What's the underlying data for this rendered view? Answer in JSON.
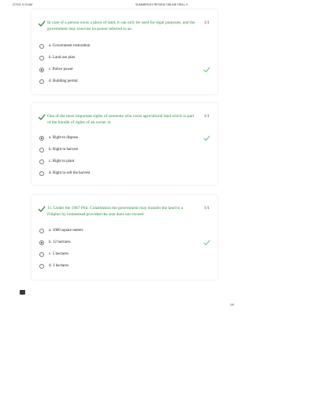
{
  "header": {
    "date": "2/7/23, 9:19 AM",
    "title": "SUMMERLEX REVIEW ONLINE DRILL 9"
  },
  "colors": {
    "correct_green": "#2e8b3c",
    "check_green": "#5cbf6a"
  },
  "questions": [
    {
      "text": "In case of a person owns a piece of land, it can only be used for legal purposes, and the government may exercise its power referred to as:",
      "points": "1/1",
      "status_icon": "check-icon",
      "options": [
        {
          "label": "a. Government restoration",
          "selected": false,
          "correct": false
        },
        {
          "label": "b. Land use plan",
          "selected": false,
          "correct": false
        },
        {
          "label": "c. Police power",
          "selected": true,
          "correct": true
        },
        {
          "label": "d. Building permit",
          "selected": false,
          "correct": false
        }
      ]
    },
    {
      "text": "One of the most important rights of someone who owns agricultural land which is part of the bundle of rights of an owner is:",
      "points": "1/1",
      "status_icon": "check-icon",
      "options": [
        {
          "label": "a. Right to dispose",
          "selected": true,
          "correct": true
        },
        {
          "label": "b. Right to harvest",
          "selected": false,
          "correct": false
        },
        {
          "label": "c. Right to plant",
          "selected": false,
          "correct": false
        },
        {
          "label": "d. Right to sell the harvest",
          "selected": false,
          "correct": false
        }
      ]
    },
    {
      "text": "11.     Under the 1987 Phil. Constitution the government may transfer the land to a Filipino by homestead provided the size does not exceed",
      "points": "1/1",
      "status_icon": "check-icon",
      "options": [
        {
          "label": "a. 1000 square meters",
          "selected": false,
          "correct": false
        },
        {
          "label": "b. 12 hectares",
          "selected": true,
          "correct": true
        },
        {
          "label": "c. 5 hectares",
          "selected": false,
          "correct": false
        },
        {
          "label": "d. 3 hectares",
          "selected": false,
          "correct": false
        }
      ]
    }
  ],
  "footer": {
    "page": "1/9",
    "float_icon": "message-icon"
  }
}
